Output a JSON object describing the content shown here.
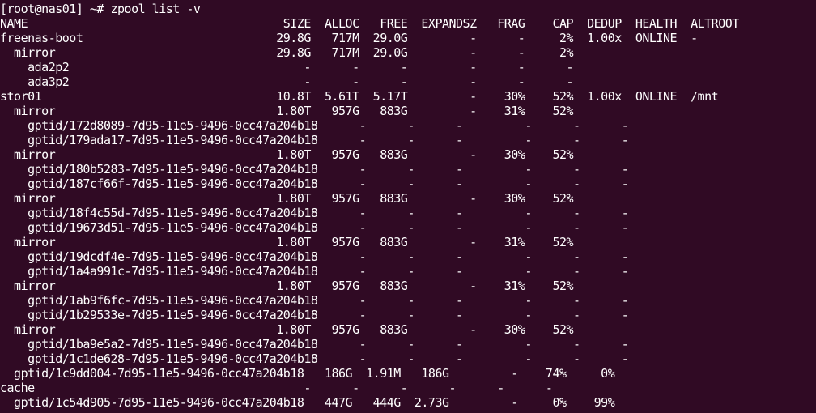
{
  "terminal": {
    "background": "#300a24",
    "foreground": "#ffffff",
    "prompt": "[root@nas01] ~#",
    "command": "zpool list -v",
    "lines": [
      "[root@nas01] ~# zpool list -v",
      "NAME                                     SIZE  ALLOC   FREE  EXPANDSZ   FRAG    CAP  DEDUP  HEALTH  ALTROOT",
      "freenas-boot                            29.8G   717M  29.0G         -      -     2%  1.00x  ONLINE  -",
      "  mirror                                29.8G   717M  29.0G         -      -     2%",
      "    ada2p2                                  -      -      -         -      -      -",
      "    ada3p2                                  -      -      -         -      -      -",
      "stor01                                  10.8T  5.61T  5.17T         -    30%    52%  1.00x  ONLINE  /mnt",
      "  mirror                                1.80T   957G   883G         -    31%    52%",
      "    gptid/172d8089-7d95-11e5-9496-0cc47a204b18      -      -      -         -      -      -",
      "    gptid/179ada17-7d95-11e5-9496-0cc47a204b18      -      -      -         -      -      -",
      "  mirror                                1.80T   957G   883G         -    30%    52%",
      "    gptid/180b5283-7d95-11e5-9496-0cc47a204b18      -      -      -         -      -      -",
      "    gptid/187cf66f-7d95-11e5-9496-0cc47a204b18      -      -      -         -      -      -",
      "  mirror                                1.80T   957G   883G         -    30%    52%",
      "    gptid/18f4c55d-7d95-11e5-9496-0cc47a204b18      -      -      -         -      -      -",
      "    gptid/19673d51-7d95-11e5-9496-0cc47a204b18      -      -      -         -      -      -",
      "  mirror                                1.80T   957G   883G         -    31%    52%",
      "    gptid/19dcdf4e-7d95-11e5-9496-0cc47a204b18      -      -      -         -      -      -",
      "    gptid/1a4a991c-7d95-11e5-9496-0cc47a204b18      -      -      -         -      -      -",
      "  mirror                                1.80T   957G   883G         -    31%    52%",
      "    gptid/1ab9f6fc-7d95-11e5-9496-0cc47a204b18      -      -      -         -      -      -",
      "    gptid/1b29533e-7d95-11e5-9496-0cc47a204b18      -      -      -         -      -      -",
      "  mirror                                1.80T   957G   883G         -    30%    52%",
      "    gptid/1ba9e5a2-7d95-11e5-9496-0cc47a204b18      -      -      -         -      -      -",
      "    gptid/1c1de628-7d95-11e5-9496-0cc47a204b18      -      -      -         -      -      -",
      "  gptid/1c9dd004-7d95-11e5-9496-0cc47a204b18   186G  1.91M   186G         -    74%     0%",
      "cache                                       -      -      -      -      -      -",
      "  gptid/1c54d905-7d95-11e5-9496-0cc47a204b18   447G   444G  2.73G         -     0%    99%"
    ]
  }
}
